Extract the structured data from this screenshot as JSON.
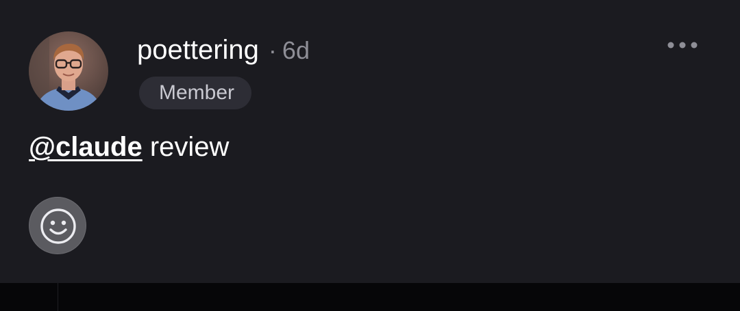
{
  "comment": {
    "author": "poettering",
    "separator": "·",
    "time_ago": "6d",
    "role_badge": "Member",
    "mention": "@claude",
    "body_text": " review"
  },
  "icons": {
    "avatar": "user-avatar-photo",
    "more": "more-horizontal-icon",
    "reaction": "smiley-face-icon"
  },
  "colors": {
    "background": "#1b1b20",
    "text_primary": "#ffffff",
    "text_muted": "#8e8e96",
    "badge_background": "#2d2d35",
    "reaction_button": "#5b5b60",
    "bottom_bar": "#060608"
  }
}
